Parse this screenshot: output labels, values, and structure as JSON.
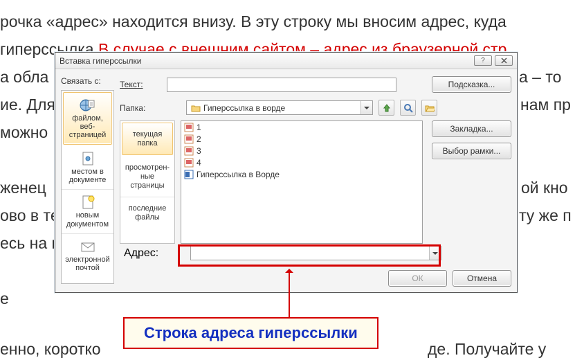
{
  "bg_lines": {
    "l1": "рочка «адрес» находится внизу. В эту строку мы вносим адрес, куда",
    "l2a": "гиперссылка",
    "l2b": "В случае с внешним сайтом – адрес из браузерной стр",
    "l3a": "а обла",
    "l3b": "а – то",
    "l4a": "ие. Для",
    "l4b": "нам пр",
    "l5": "можно",
    "l6a": "женец",
    "l6b": "ой кно",
    "l7a": "ово в те",
    "l7b": "ту же п",
    "l8a": "есь на н",
    "l9": "е",
    "l10a": "енно, коротко",
    "l10b": "де. Получайте у"
  },
  "dialog": {
    "title": "Вставка гиперссылки",
    "linkwith_label": "Связать с:",
    "text_label": "Текст:",
    "text_value": "",
    "hint_btn": "Подсказка...",
    "folder_label": "Папка:",
    "folder_value": "Гиперссылка в ворде",
    "bookmark_btn": "Закладка...",
    "target_btn": "Выбор рамки...",
    "addr_label": "Адрес:",
    "addr_value": "",
    "ok": "ОК",
    "cancel": "Отмена"
  },
  "sidebar": {
    "items": [
      "файлом, веб-страницей",
      "местом в документе",
      "новым документом",
      "электронной почтой"
    ]
  },
  "nav2": {
    "items": [
      "текущая папка",
      "просмотрен-ные страницы",
      "последние файлы"
    ]
  },
  "files": {
    "rows": [
      "1",
      "2",
      "3",
      "4",
      "Гиперссылка в Ворде"
    ]
  },
  "callout": "Строка адреса гиперссылки"
}
